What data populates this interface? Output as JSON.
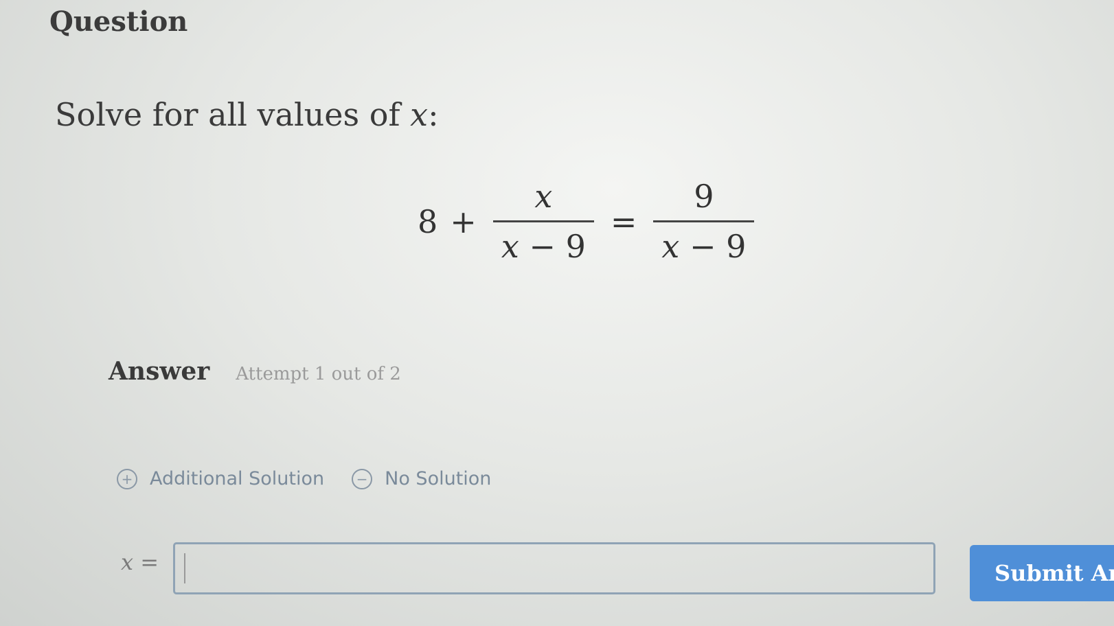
{
  "question": {
    "heading": "Question",
    "prompt_prefix": "Solve for all values of ",
    "prompt_var": "x",
    "prompt_suffix": ":"
  },
  "equation": {
    "constant": "8",
    "plus": "+",
    "left_numerator": "x",
    "left_denominator_var": "x",
    "left_denominator_rest": " − 9",
    "equals": "=",
    "right_numerator": "9",
    "right_denominator_var": "x",
    "right_denominator_rest": " − 9"
  },
  "answer": {
    "label": "Answer",
    "attempt": "Attempt 1 out of 2",
    "options": {
      "additional": {
        "icon": "plus-circle-icon",
        "glyph": "+",
        "label": "Additional Solution"
      },
      "none": {
        "icon": "minus-circle-icon",
        "glyph": "−",
        "label": "No Solution"
      }
    },
    "input_var": "x",
    "input_eq": " =",
    "input_value": "",
    "submit_label": "Submit An"
  },
  "colors": {
    "submit_bg": "#4f8fd8",
    "input_border": "#8fa3b5",
    "muted_text": "#7a8a9a"
  }
}
